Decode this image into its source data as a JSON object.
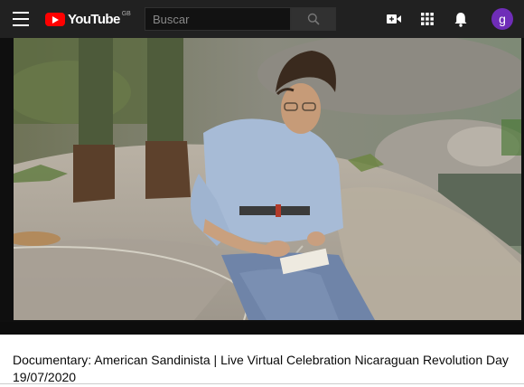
{
  "header": {
    "logo_text": "YouTube",
    "logo_country": "GB",
    "search": {
      "placeholder": "Buscar",
      "value": ""
    },
    "avatar_letter": "g"
  },
  "video": {
    "title": "Documentary: American Sandinista | Live Virtual Celebration Nicaraguan Revolution Day 19/07/2020"
  },
  "icons": [
    "menu-icon",
    "youtube-logo-icon",
    "search-icon",
    "create-video-icon",
    "apps-grid-icon",
    "notifications-bell-icon"
  ],
  "colors": {
    "topbar": "#212121",
    "brand_red": "#ff0000",
    "avatar": "#6f2db8",
    "player_bg": "#0f0f0f"
  }
}
